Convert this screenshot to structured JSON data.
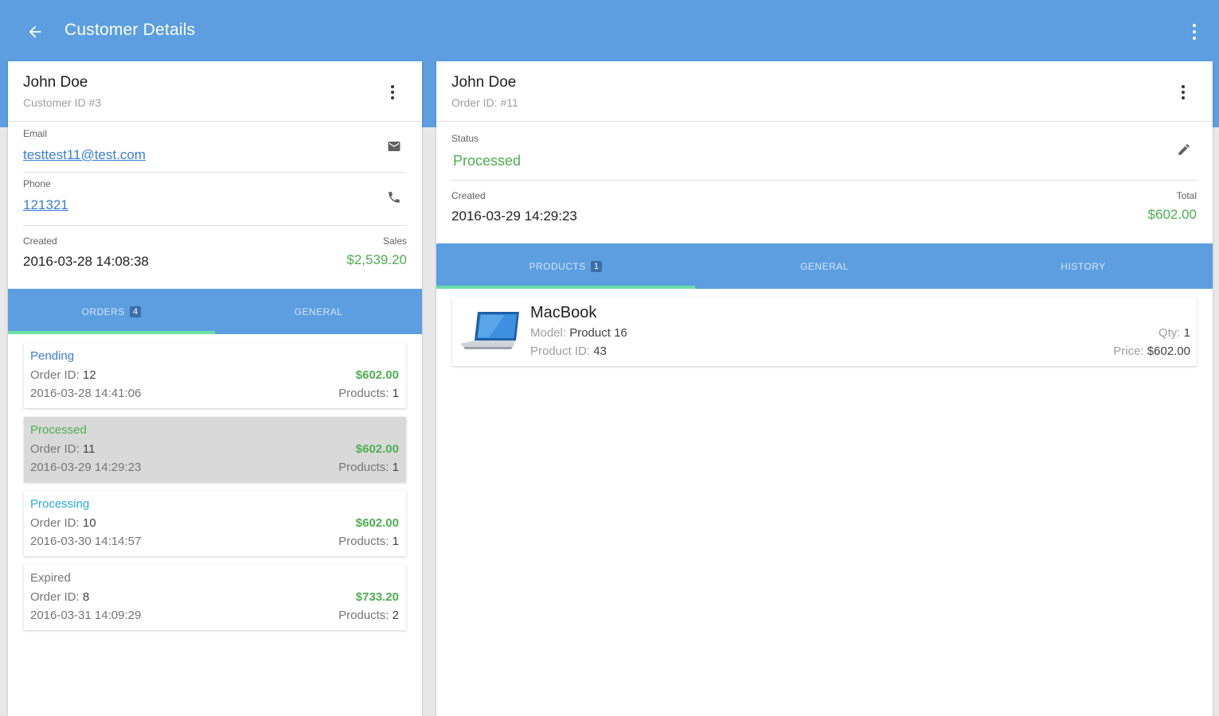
{
  "app": {
    "title": "Customer Details",
    "back_icon": "arrow-left-icon",
    "menu_icon": "more-vert-icon",
    "accent_color": "#5c9ee0"
  },
  "customer": {
    "name": "John Doe",
    "subtitle": "Customer ID #3",
    "email_label": "Email",
    "email": "testtest11@test.com",
    "phone_label": "Phone",
    "phone": "121321",
    "created_label": "Created",
    "created": "2016-03-28 14:08:38",
    "sales_label": "Sales",
    "sales": "$2,539.20",
    "tabs": [
      {
        "label": "ORDERS",
        "badge": "4",
        "active": true
      },
      {
        "label": "GENERAL",
        "badge": "",
        "active": false
      }
    ],
    "orders": [
      {
        "status": "Pending",
        "order_id_label": "Order ID:",
        "order_id": "12",
        "date": "2016-03-28 14:41:06",
        "amount": "$602.00",
        "products_label": "Products:",
        "products": "1"
      },
      {
        "status": "Processed",
        "order_id_label": "Order ID:",
        "order_id": "11",
        "date": "2016-03-29 14:29:23",
        "amount": "$602.00",
        "products_label": "Products:",
        "products": "1"
      },
      {
        "status": "Processing",
        "order_id_label": "Order ID:",
        "order_id": "10",
        "date": "2016-03-30 14:14:57",
        "amount": "$602.00",
        "products_label": "Products:",
        "products": "1"
      },
      {
        "status": "Expired",
        "order_id_label": "Order ID:",
        "order_id": "8",
        "date": "2016-03-31 14:09:29",
        "amount": "$733.20",
        "products_label": "Products:",
        "products": "2"
      }
    ]
  },
  "order": {
    "name": "John Doe",
    "subtitle": "Order ID: #11",
    "status_label": "Status",
    "status": "Processed",
    "created_label": "Created",
    "created": "2016-03-29 14:29:23",
    "total_label": "Total",
    "total": "$602.00",
    "tabs": [
      {
        "label": "PRODUCTS",
        "badge": "1",
        "active": true
      },
      {
        "label": "GENERAL",
        "badge": "",
        "active": false
      },
      {
        "label": "HISTORY",
        "badge": "",
        "active": false
      }
    ],
    "product": {
      "name": "MacBook",
      "model_label": "Model:",
      "model": "Product 16",
      "pid_label": "Product ID:",
      "pid": "43",
      "qty_label": "Qty:",
      "qty": "1",
      "price_label": "Price:",
      "price": "$602.00"
    }
  }
}
